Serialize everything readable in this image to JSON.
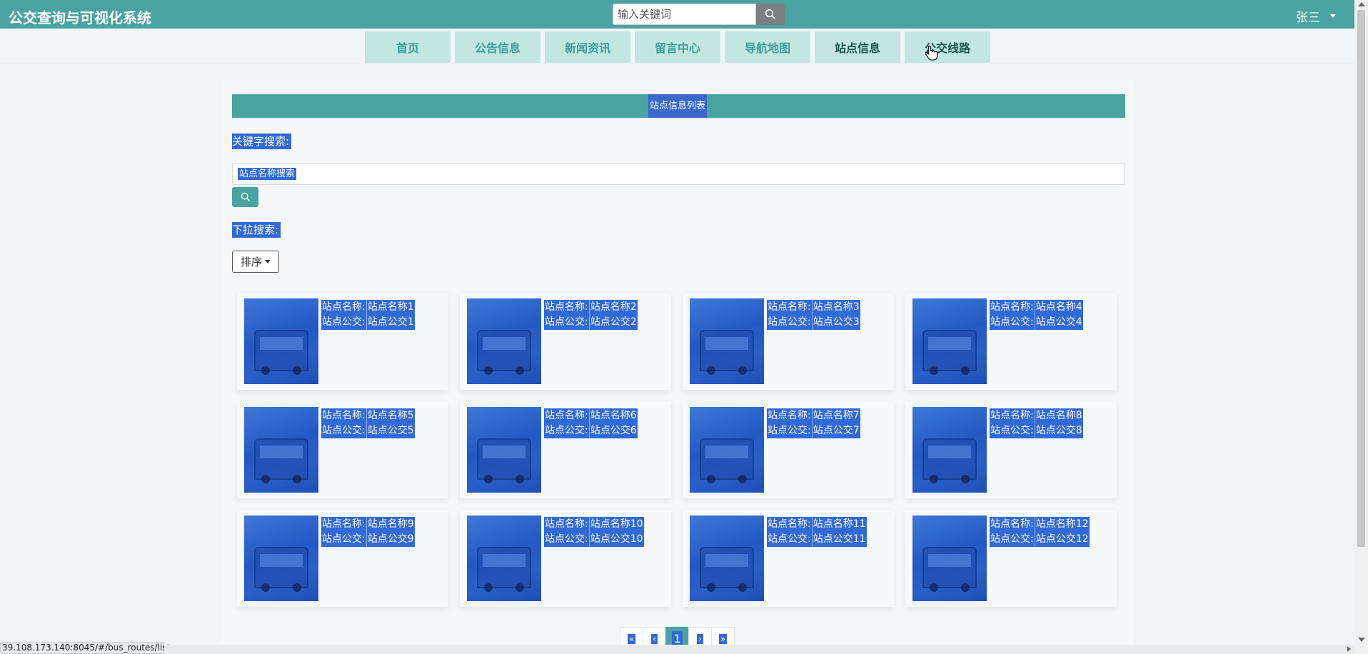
{
  "app": {
    "title": "公交查询与可视化系统"
  },
  "search": {
    "placeholder": "输入关键词"
  },
  "user": {
    "name": "张三"
  },
  "nav": {
    "items": [
      {
        "label": "首页"
      },
      {
        "label": "公告信息"
      },
      {
        "label": "新闻资讯"
      },
      {
        "label": "留言中心"
      },
      {
        "label": "导航地图"
      },
      {
        "label": "站点信息"
      },
      {
        "label": "公交线路"
      }
    ]
  },
  "list": {
    "title": "站点信息列表",
    "keyword_label": "关键字搜索:",
    "keyword_placeholder": "站点名称搜索",
    "dropdown_label": "下拉搜索:",
    "sort_label": "排序"
  },
  "cards": [
    {
      "name_key": "站点名称:",
      "name": "站点名称1",
      "bus_key": "站点公交:",
      "bus": "站点公交1"
    },
    {
      "name_key": "站点名称:",
      "name": "站点名称2",
      "bus_key": "站点公交:",
      "bus": "站点公交2"
    },
    {
      "name_key": "站点名称:",
      "name": "站点名称3",
      "bus_key": "站点公交:",
      "bus": "站点公交3"
    },
    {
      "name_key": "站点名称:",
      "name": "站点名称4",
      "bus_key": "站点公交:",
      "bus": "站点公交4"
    },
    {
      "name_key": "站点名称:",
      "name": "站点名称5",
      "bus_key": "站点公交:",
      "bus": "站点公交5"
    },
    {
      "name_key": "站点名称:",
      "name": "站点名称6",
      "bus_key": "站点公交:",
      "bus": "站点公交6"
    },
    {
      "name_key": "站点名称:",
      "name": "站点名称7",
      "bus_key": "站点公交:",
      "bus": "站点公交7"
    },
    {
      "name_key": "站点名称:",
      "name": "站点名称8",
      "bus_key": "站点公交:",
      "bus": "站点公交8"
    },
    {
      "name_key": "站点名称:",
      "name": "站点名称9",
      "bus_key": "站点公交:",
      "bus": "站点公交9"
    },
    {
      "name_key": "站点名称:",
      "name": "站点名称10",
      "bus_key": "站点公交:",
      "bus": "站点公交10"
    },
    {
      "name_key": "站点名称:",
      "name": "站点名称11",
      "bus_key": "站点公交:",
      "bus": "站点公交11"
    },
    {
      "name_key": "站点名称:",
      "name": "站点名称12",
      "bus_key": "站点公交:",
      "bus": "站点公交12"
    }
  ],
  "pagination": {
    "first": "«",
    "prev": "‹",
    "current": "1",
    "next": "›",
    "last": "»"
  },
  "status_url": "39.108.173.140:8045/#/bus_routes/list",
  "colors": {
    "primary": "#4aa3a0",
    "nav_bg": "#c2e6e1",
    "selection": "#3169d6"
  }
}
